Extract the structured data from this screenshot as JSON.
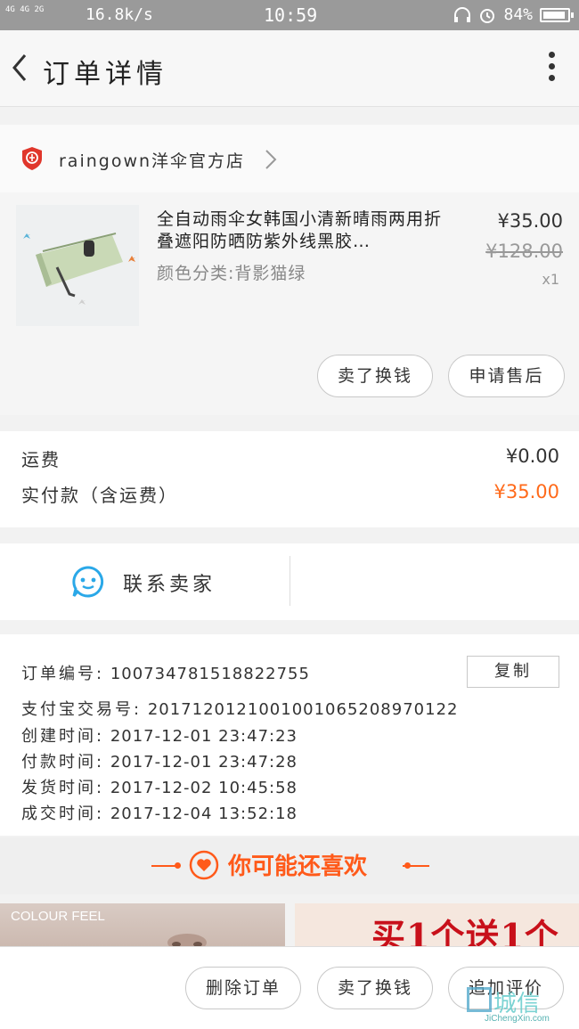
{
  "status_bar": {
    "signal": "4G 4G 2G",
    "speed": "16.8k/s",
    "time": "10:59",
    "battery": "84%"
  },
  "header": {
    "title": "订单详情"
  },
  "shop": {
    "name": "raingown洋伞官方店"
  },
  "product": {
    "title": "全自动雨伞女韩国小清新晴雨两用折叠遮阳防晒防紫外线黑胶…",
    "sku": "颜色分类:背影猫绿",
    "price": "¥35.00",
    "original_price": "¥128.00",
    "quantity": "x1",
    "buttons": {
      "resell": "卖了换钱",
      "after_sale": "申请售后"
    }
  },
  "cost": {
    "shipping_label": "运费",
    "shipping_value": "¥0.00",
    "paid_label": "实付款（含运费）",
    "paid_value": "¥35.00"
  },
  "contact": {
    "label": "联系卖家"
  },
  "order_info": {
    "order_no_label": "订单编号:",
    "order_no": "100734781518822755",
    "copy_label": "复制",
    "alipay_label": "支付宝交易号:",
    "alipay_no": "2017120121001001065208970122",
    "created_label": "创建时间:",
    "created": "2017-12-01 23:47:23",
    "paid_label": "付款时间:",
    "paid": "2017-12-01 23:47:28",
    "shipped_label": "发货时间:",
    "shipped": "2017-12-02 10:45:58",
    "completed_label": "成交时间:",
    "completed": "2017-12-04 13:52:18"
  },
  "recommend": {
    "title": "你可能还喜欢",
    "item1_brand": "COLOUR FEEL",
    "item2_promo": "买1个送1个"
  },
  "bottom_bar": {
    "delete": "删除订单",
    "resell": "卖了换钱",
    "add_review": "追加评价"
  },
  "watermark": {
    "text": "城信",
    "url": "JiChengXin.com"
  },
  "colors": {
    "accent": "#ff6a1a",
    "contact_icon": "#2aa8e8",
    "shop_logo": "#e0362b"
  }
}
